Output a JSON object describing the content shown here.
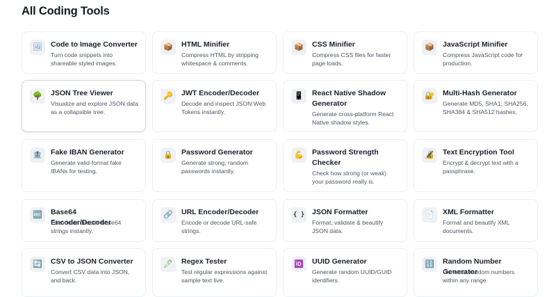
{
  "page": {
    "title": "All Coding Tools"
  },
  "tools": [
    {
      "title": "Code to Image Converter",
      "desc": "Turn code snippets into shareable styled images.",
      "icon": "image-icon",
      "glyph": "🖼",
      "color": "#5b8fd6"
    },
    {
      "title": "HTML Minifier",
      "desc": "Compress HTML by stripping whitespace & comments.",
      "icon": "package-icon",
      "glyph": "📦",
      "color": "#b07a3c"
    },
    {
      "title": "CSS Minifier",
      "desc": "Compress CSS files for faster page loads.",
      "icon": "package-icon",
      "glyph": "📦",
      "color": "#b07a3c"
    },
    {
      "title": "JavaScript Minifier",
      "desc": "Compress JavaScript code for production.",
      "icon": "package-icon",
      "glyph": "📦",
      "color": "#b07a3c"
    },
    {
      "title": "JSON Tree Viewer",
      "desc": "Visualize and explore JSON data as a collapsible tree.",
      "icon": "tree-icon",
      "glyph": "🌳",
      "color": "#3f8f3a"
    },
    {
      "title": "JWT Encoder/Decoder",
      "desc": "Decode and inspect JSON Web Tokens instantly.",
      "icon": "key-icon",
      "glyph": "🔑",
      "color": "#d9a22b"
    },
    {
      "title": "React Native Shadow Generator",
      "desc": "Generate cross-platform React Native shadow styles.",
      "icon": "phone-icon",
      "glyph": "📱",
      "color": "#6b4fa8"
    },
    {
      "title": "Multi-Hash Generator",
      "desc": "Generate MD5, SHA1, SHA256, SHA384 & SHA512 hashes.",
      "icon": "lock-icon",
      "glyph": "🔐",
      "color": "#d9a22b"
    },
    {
      "title": "Fake IBAN Generator",
      "desc": "Generate valid-format fake IBANs for testing.",
      "icon": "bank-icon",
      "glyph": "🏦",
      "color": "#6b7280"
    },
    {
      "title": "Password Generator",
      "desc": "Generate strong, random passwords instantly.",
      "icon": "lock-icon",
      "glyph": "🔒",
      "color": "#d9a22b"
    },
    {
      "title": "Password Strength Checker",
      "desc": "Check how strong (or weak) your password really is.",
      "icon": "muscle-icon",
      "glyph": "💪",
      "color": "#e0a126"
    },
    {
      "title": "Text Encryption Tool",
      "desc": "Encrypt & decrypt text with a passphrase.",
      "icon": "lock-icon",
      "glyph": "🔏",
      "color": "#d9a22b"
    },
    {
      "title": "Base64 Encoder/Decoder",
      "desc": "Encode or decode Base64 strings instantly.",
      "icon": "abc-icon",
      "glyph": "🔤",
      "color": "#3b7bd4"
    },
    {
      "title": "URL Encoder/Decoder",
      "desc": "Encode or decode URL-safe strings.",
      "icon": "link-icon",
      "glyph": "🔗",
      "color": "#8a8f99"
    },
    {
      "title": "JSON Formatter",
      "desc": "Format, validate & beautify JSON data.",
      "icon": "braces-icon",
      "glyph": "{ }",
      "color": "#2a2f3a"
    },
    {
      "title": "XML Formatter",
      "desc": "Format and beautify XML documents.",
      "icon": "document-icon",
      "glyph": "📄",
      "color": "#6b7280"
    },
    {
      "title": "CSV to JSON Converter",
      "desc": "Convert CSV data into JSON, and back.",
      "icon": "spreadsheet-icon",
      "glyph": "🔄",
      "color": "#3b7bd4"
    },
    {
      "title": "Regex Tester",
      "desc": "Test regular expressions against sample text live.",
      "icon": "pencil-icon",
      "glyph": "🖊",
      "color": "#5fa84a"
    },
    {
      "title": "UUID Generator",
      "desc": "Generate random UUID/GUID identifiers.",
      "icon": "id-icon",
      "glyph": "🆔",
      "color": "#6b4fa8"
    },
    {
      "title": "Random Number Generator",
      "desc": "Generate random numbers within any range.",
      "icon": "numbers-icon",
      "glyph": "🔢",
      "color": "#6b4fa8"
    }
  ]
}
